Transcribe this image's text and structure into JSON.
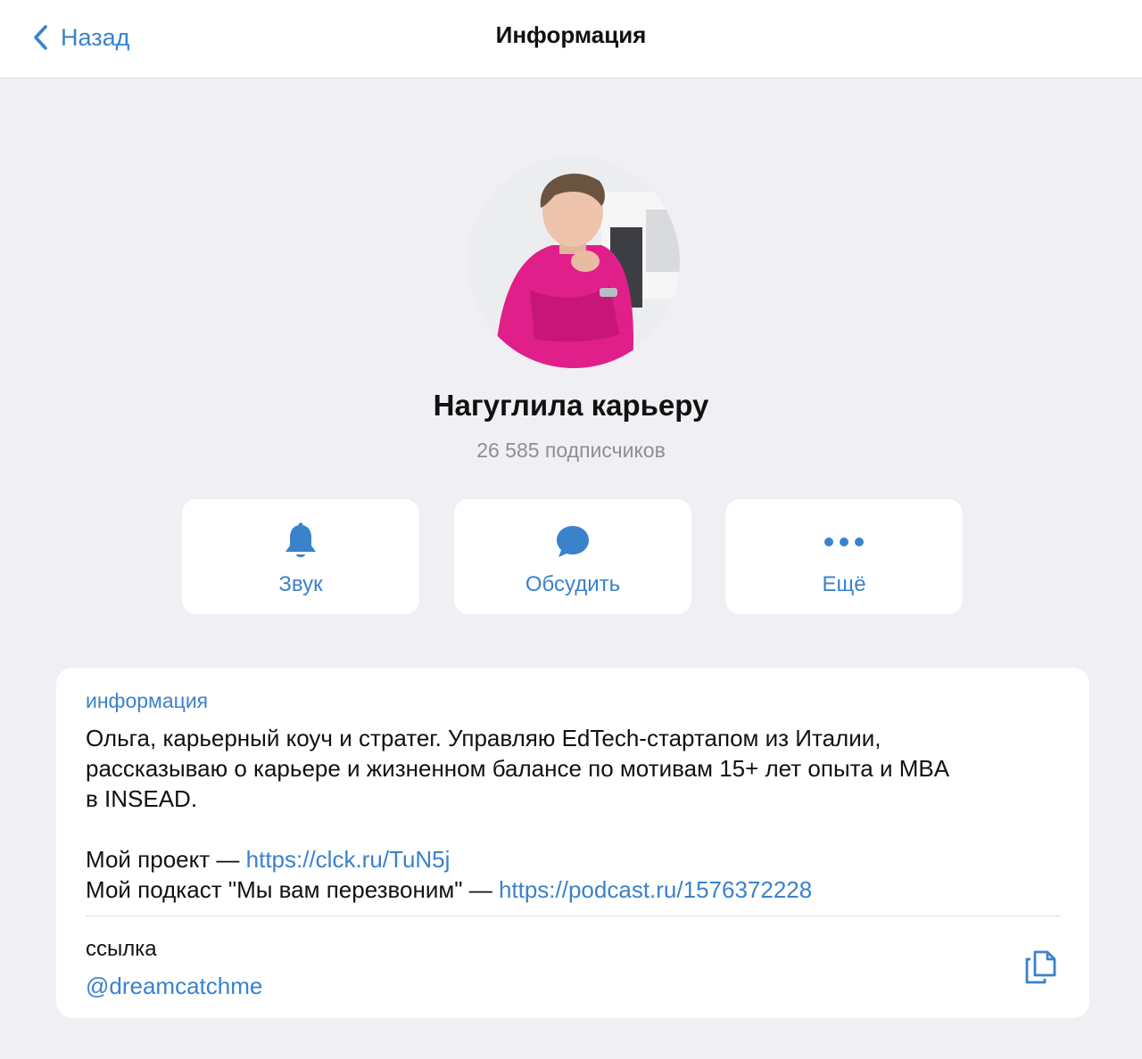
{
  "nav": {
    "back_label": "Назад",
    "title": "Информация"
  },
  "channel": {
    "name": "Нагуглила карьеру",
    "subscribers": "26 585 подписчиков"
  },
  "actions": [
    {
      "label": "Звук",
      "icon": "bell-icon"
    },
    {
      "label": "Обсудить",
      "icon": "chat-bubble-icon"
    },
    {
      "label": "Ещё",
      "icon": "more-dots-icon"
    }
  ],
  "info": {
    "label": "информация",
    "description_line1": "Ольга, карьерный коуч и стратег. Управляю EdTech-стартапом из Италии,",
    "description_line2": "рассказываю о карьере и жизненном балансе по мотивам 15+ лет опыта и MBA",
    "description_line3": "в INSEAD.",
    "project_prefix": "Мой проект — ",
    "project_link": "https://clck.ru/TuN5j",
    "podcast_prefix": "Мой подкаст \"Мы вам перезвоним\" — ",
    "podcast_link": "https://podcast.ru/1576372228"
  },
  "link_section": {
    "label": "ссылка",
    "username": "@dreamcatchme",
    "copy_icon": "copy-icon"
  },
  "colors": {
    "accent": "#3a82cc",
    "background": "#efeff4",
    "card": "#ffffff",
    "secondary_text": "#8e8e93"
  }
}
